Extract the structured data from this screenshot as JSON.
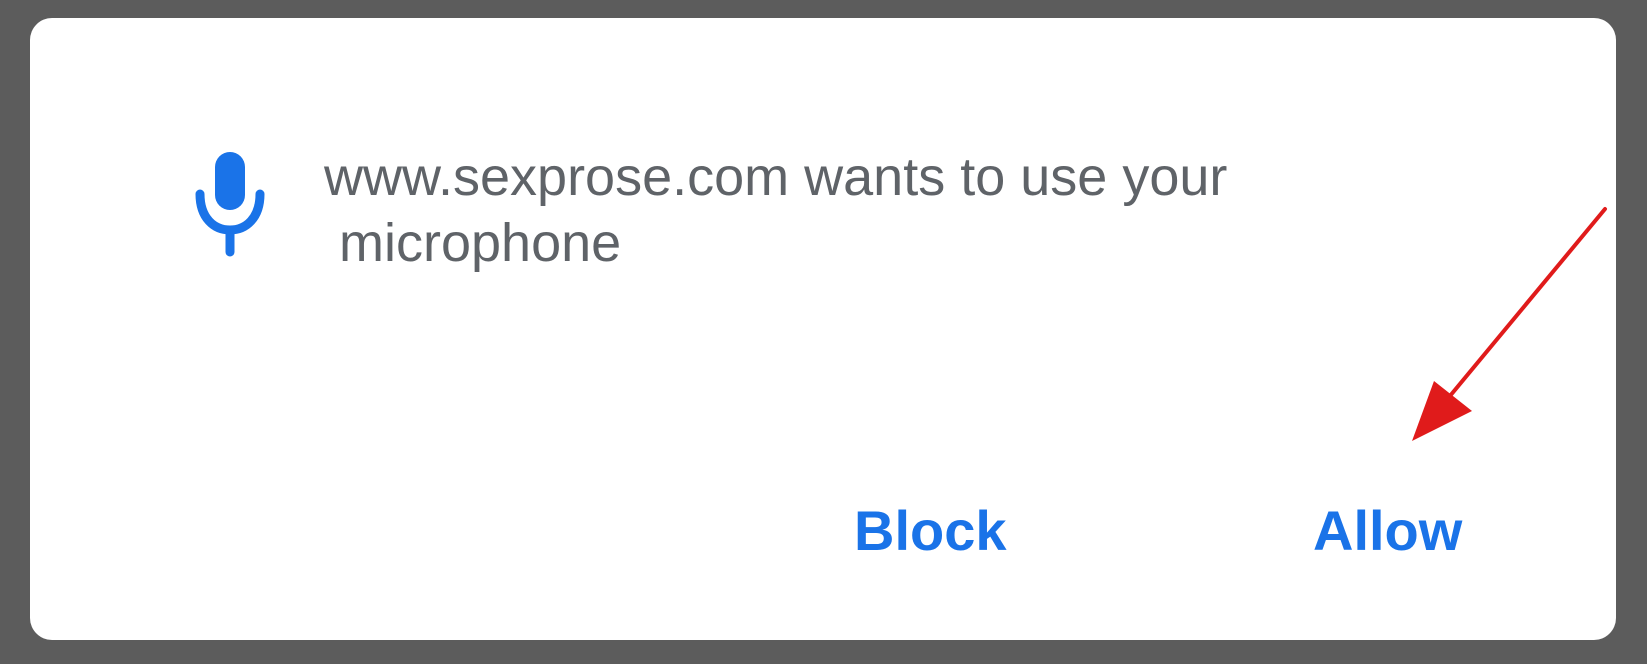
{
  "prompt": {
    "icon": "microphone-icon",
    "message": "www.sexprose.com wants to use your\n microphone"
  },
  "actions": {
    "block_label": "Block",
    "allow_label": "Allow"
  },
  "annotation": {
    "icon": "arrow-icon",
    "target": "allow-button"
  },
  "colors": {
    "accent": "#1a73e8",
    "text": "#5f6368",
    "backdrop": "#5c5c5c",
    "annotation": "#e01b1b"
  }
}
